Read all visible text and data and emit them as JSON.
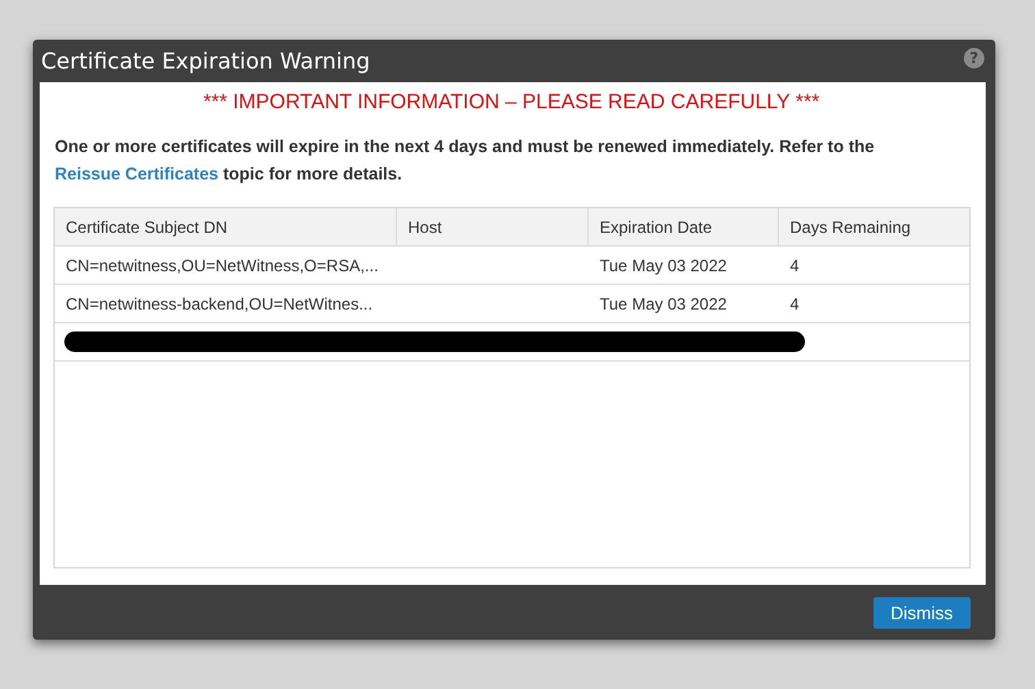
{
  "dialog": {
    "title": "Certificate Expiration Warning",
    "help_icon": "?",
    "banner": "*** IMPORTANT INFORMATION – PLEASE READ CAREFULLY ***",
    "message": "One or more certificates will expire in the next 4 days and must be renewed immediately. Refer to the",
    "link": "Reissue Certificates",
    "message_end": "topic for more details.",
    "table": {
      "columns": [
        "Certificate Subject DN",
        "Host",
        "Expiration Date",
        "Days Remaining"
      ],
      "rows": [
        {
          "kind": "data",
          "cells": [
            "CN=netwitness,OU=NetWitness,O=RSA,...",
            "",
            "Tue May 03 2022",
            "4"
          ]
        },
        {
          "kind": "data",
          "cells": [
            "CN=netwitness-backend,OU=NetWitnes...",
            "",
            "Tue May 03 2022",
            "4"
          ]
        },
        {
          "kind": "redacted",
          "cells": []
        }
      ]
    },
    "buttons": [
      "Dismiss"
    ]
  }
}
